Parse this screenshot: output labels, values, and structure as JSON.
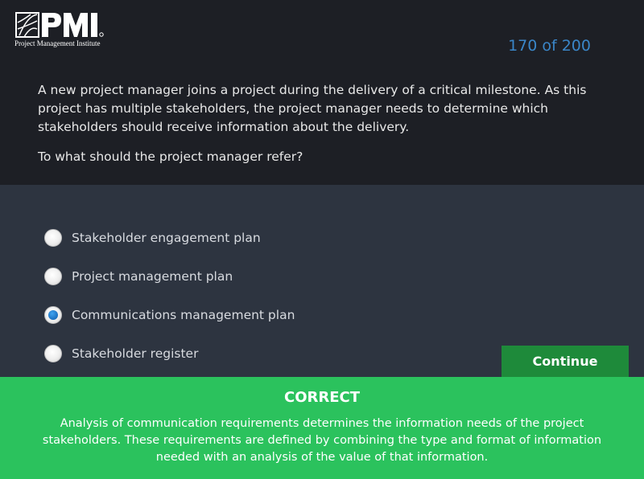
{
  "header": {
    "logo_text": "PMI",
    "logo_subtitle": "Project Management Institute",
    "counter": "170 of 200"
  },
  "question": {
    "text": "A new project manager joins a project during the delivery of a critical milestone.  As this project has multiple stakeholders, the project manager needs to determine which stakeholders should receive information about the delivery.",
    "prompt": "To what should the project manager refer?"
  },
  "options": [
    {
      "label": "Stakeholder engagement plan",
      "selected": false
    },
    {
      "label": "Project management plan",
      "selected": false
    },
    {
      "label": "Communications management plan",
      "selected": true
    },
    {
      "label": "Stakeholder register",
      "selected": false
    }
  ],
  "continue_label": "Continue",
  "feedback": {
    "title": "CORRECT",
    "text": "Analysis of communication requirements determines the information needs of the project stakeholders. These requirements are defined by combining the type and format of information needed with an analysis of the value of that information."
  },
  "colors": {
    "header_bg": "#1d1f25",
    "body_bg": "#2d3440",
    "accent_blue": "#3a86c8",
    "continue_bg": "#1e8a3a",
    "feedback_bg": "#2bc25d"
  }
}
